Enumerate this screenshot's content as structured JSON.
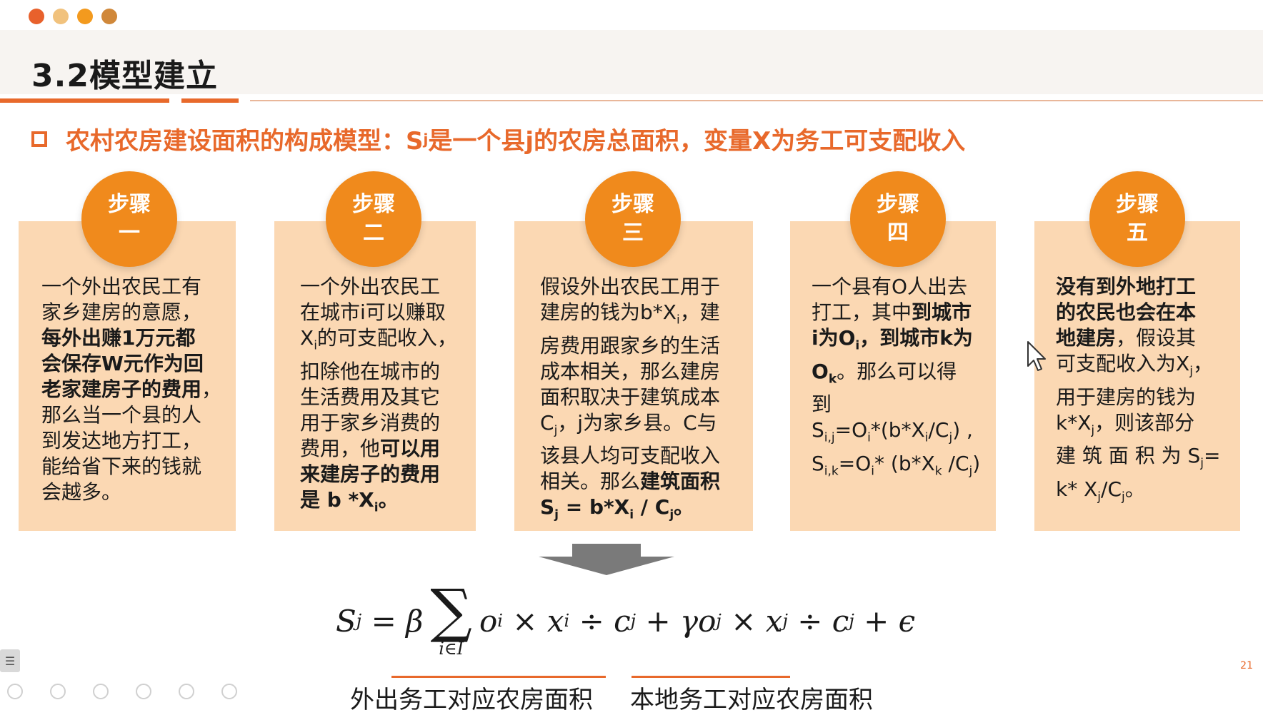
{
  "window_dots": [
    "#e8612c",
    "#f1c27d",
    "#f39a1e",
    "#d0883a"
  ],
  "title": "3.2模型建立",
  "subtitle": {
    "prefix": "农村农房建设面积的构成模型：S",
    "sub": "j",
    "suffix": "是一个县j的农房总面积，变量X为务工可支配收入"
  },
  "steps": [
    {
      "line1": "步骤",
      "line2": "一"
    },
    {
      "line1": "步骤",
      "line2": "二"
    },
    {
      "line1": "步骤",
      "line2": "三"
    },
    {
      "line1": "步骤",
      "line2": "四"
    },
    {
      "line1": "步骤",
      "line2": "五"
    }
  ],
  "cards": {
    "c1": {
      "l1": "一个外出农民工有",
      "l2": "家乡建房的意愿，",
      "l3": "每外出赚1万元都",
      "l4": "会保存W元作为回",
      "l5": "老家建房子的费用",
      "l5b": "，",
      "l6": "那么当一个县的人",
      "l7": "到发达地方打工，",
      "l8": "能给省下来的钱就",
      "l9": "会越多。"
    },
    "c2": {
      "l1": "一个外出农民工",
      "l2": "在城市i可以赚取",
      "l3a": "X",
      "l3s": "i",
      "l3b": "的可支配收入，",
      "l4": "扣除他在城市的",
      "l5": "生活费用及其它",
      "l6": "用于家乡消费的",
      "l7a": "费用，他",
      "l7b": "可以用",
      "l8": "来建房子的费用",
      "l9a": "是 b *X",
      "l9s": "i",
      "l9b": "。"
    },
    "c3": {
      "l1": "假设外出农民工用于",
      "l2a": "建房的钱为b*X",
      "l2s": "i",
      "l2b": "，建",
      "l3": "房费用跟家乡的生活",
      "l4": "成本相关，那么建房",
      "l5": "面积取决于建筑成本",
      "l6a": "C",
      "l6s": "j",
      "l6b": "，j为家乡县。C与",
      "l7": "该县人均可支配收入",
      "l8a": "相关。那么",
      "l8b": "建筑面积",
      "l9a": "S",
      "l9s1": "j",
      "l9b": " = b*X",
      "l9s2": "i",
      "l9c": " / C",
      "l9s3": "j",
      "l9d": "。"
    },
    "c4": {
      "l1": "一个县有O人出去",
      "l2a": "打工，其中",
      "l2b": "到城市",
      "l3a": "i为O",
      "l3s": "i",
      "l3b": "，到城市k为",
      "l4a": "O",
      "l4s": "k",
      "l4b": "。那么可以得",
      "l5": "到",
      "l6a": "S",
      "l6s1": "i,j",
      "l6b": "=O",
      "l6s2": "i",
      "l6c": "*(b*X",
      "l6s3": "i",
      "l6d": "/C",
      "l6s4": "j",
      "l6e": ")   ,",
      "l7a": "S",
      "l7s1": "i,k",
      "l7b": "=O",
      "l7s2": "i",
      "l7c": "* (b*X",
      "l7s3": "k",
      "l7d": " /C",
      "l7s4": "j",
      "l7e": ")"
    },
    "c5": {
      "l1": "没有到外地打工",
      "l2": "的农民也会在本",
      "l3a": "地建房",
      "l3b": "，假设其",
      "l4a": "可支配收入为X",
      "l4s": "j",
      "l4b": "，",
      "l5": "用于建房的钱为",
      "l6a": "k*X",
      "l6s": "j",
      "l6b": "，则该部分",
      "l7a": "建 筑 面 积 为 S",
      "l7s": "j",
      "l7b": "=",
      "l8a": "k* X",
      "l8s1": "j",
      "l8b": "/C",
      "l8s2": "j",
      "l8c": "。"
    }
  },
  "formula": {
    "lhs": "S",
    "lhs_sub": "j",
    "eq_beta": " = β",
    "sigma": "∑",
    "sum_under": "i∈I",
    "t1": "o",
    "t1s": "i",
    "t2": " × x",
    "t2s": "i",
    "t3": " ÷ c",
    "t3s": "j",
    "t4": " + γo",
    "t4s": "j",
    "t5": " × x",
    "t5s": "j",
    "t6": " ÷ c",
    "t6s": "j",
    "t7": " + ϵ"
  },
  "labels": {
    "outside": "外出务工对应农房面积",
    "local": "本地务工对应农房面积"
  },
  "page_number": "21",
  "colors": {
    "accent": "#e8692b",
    "card_bg": "#fbd8b3",
    "circle": "#f08a1c"
  },
  "icons": {
    "menu": "☰"
  }
}
